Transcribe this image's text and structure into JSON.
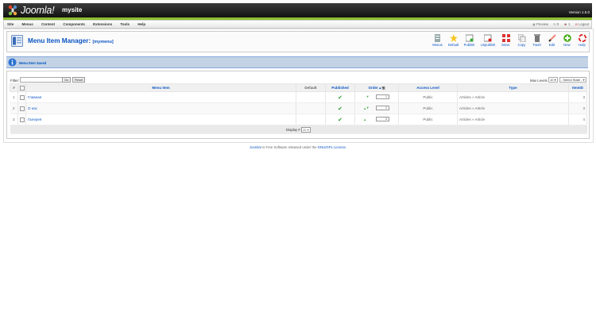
{
  "header": {
    "logo_text": "Joomla!",
    "site_name": "mysite",
    "version": "Version 1.5.0"
  },
  "menubar": {
    "items": [
      "Site",
      "Menus",
      "Content",
      "Components",
      "Extensions",
      "Tools",
      "Help"
    ],
    "preview": "Preview",
    "messages_count": "0",
    "users_count": "1",
    "logout": "Logout"
  },
  "toolbar": {
    "title": "Menu Item Manager:",
    "menu_name": "[mymenu]",
    "buttons": [
      "Menus",
      "Default",
      "Publish",
      "Unpublish",
      "Move",
      "Copy",
      "Trash",
      "Edit",
      "New",
      "Help"
    ]
  },
  "message": {
    "text": "Menu Item Saved"
  },
  "filter": {
    "label": "Filter:",
    "value": "",
    "go": "Go",
    "reset": "Reset",
    "max_levels_label": "Max Levels",
    "max_levels_value": "10",
    "state_value": "- Select State -"
  },
  "table": {
    "headers": {
      "num": "#",
      "menu_item": "Menu Item",
      "default": "Default",
      "published": "Published",
      "order": "Order",
      "access": "Access Level",
      "type": "Type",
      "itemid": "ItemID"
    },
    "rows": [
      {
        "num": "1",
        "title": "Главная",
        "order": "1",
        "access": "Public",
        "type": "Articles » Article",
        "itemid": "3"
      },
      {
        "num": "2",
        "title": "О нас",
        "order": "2",
        "access": "Public",
        "type": "Articles » Article",
        "itemid": "3"
      },
      {
        "num": "3",
        "title": "Галерея",
        "order": "3",
        "access": "Public",
        "type": "Articles » Article",
        "itemid": "4"
      }
    ],
    "display_label": "Display #",
    "display_value": "20"
  },
  "footer": {
    "link1": "Joomla!",
    "text": " is Free Software released under the ",
    "link2": "GNU/GPL License."
  }
}
